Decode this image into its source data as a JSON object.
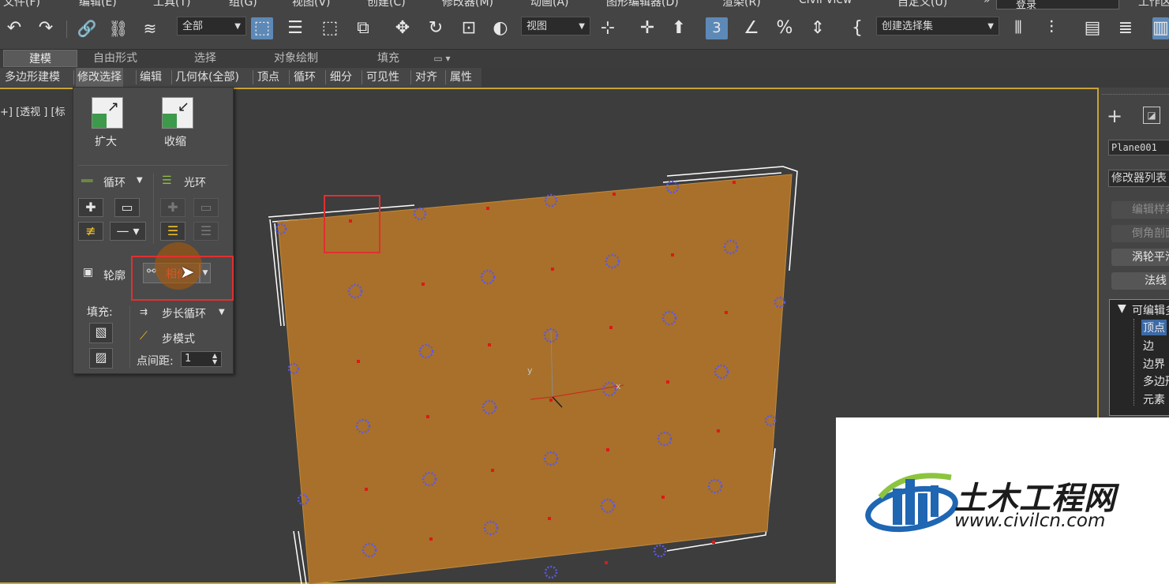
{
  "menubar": {
    "items": [
      "文件(F)",
      "编辑(E)",
      "工具(T)",
      "组(G)",
      "视图(V)",
      "创建(C)",
      "修改器(M)",
      "动画(A)",
      "图形编辑器(D)",
      "渲染(R)",
      "Civil View",
      "自定义(U)"
    ],
    "login": "登录",
    "workspace": "工作区"
  },
  "toolbar": {
    "filter_value": "全部",
    "coord_value": "视图",
    "selection_set_value": "创建选择集"
  },
  "ribbon": {
    "tabs": [
      "建模",
      "自由形式",
      "选择",
      "对象绘制",
      "填充"
    ],
    "sub_items": [
      "多边形建模",
      "修改选择",
      "编辑",
      "几何体(全部)",
      "顶点",
      "循环",
      "细分",
      "可见性",
      "对齐",
      "属性"
    ]
  },
  "viewport": {
    "label": "+] [透视 ] [标",
    "bg_color": "#3d3d3d",
    "plane_color": "#a8702a",
    "border_color": "#c9a338"
  },
  "panel": {
    "grow": "扩大",
    "shrink": "收缩",
    "loop": "循环",
    "ring": "光环",
    "outline": "轮廓",
    "similar": "相似",
    "fill": "填充:",
    "step_loop": "步长循环",
    "step_mode": "步模式",
    "point_spacing": "点间距:",
    "point_spacing_value": "1"
  },
  "command_panel": {
    "object_name": "Plane001",
    "modifier_list": "修改器列表",
    "buttons": [
      "编辑样条线",
      "倒角剖面",
      "涡轮平滑",
      "法线"
    ],
    "tree_root": "可编辑多边形",
    "tree_items": [
      "顶点",
      "边",
      "边界",
      "多边形",
      "元素"
    ]
  },
  "watermark": {
    "brand": "土木工程网",
    "url": "www.civilcn.com",
    "brand_color": "#1b1b1b",
    "accent_blue": "#1f66b3",
    "accent_green": "#8cc43f"
  }
}
